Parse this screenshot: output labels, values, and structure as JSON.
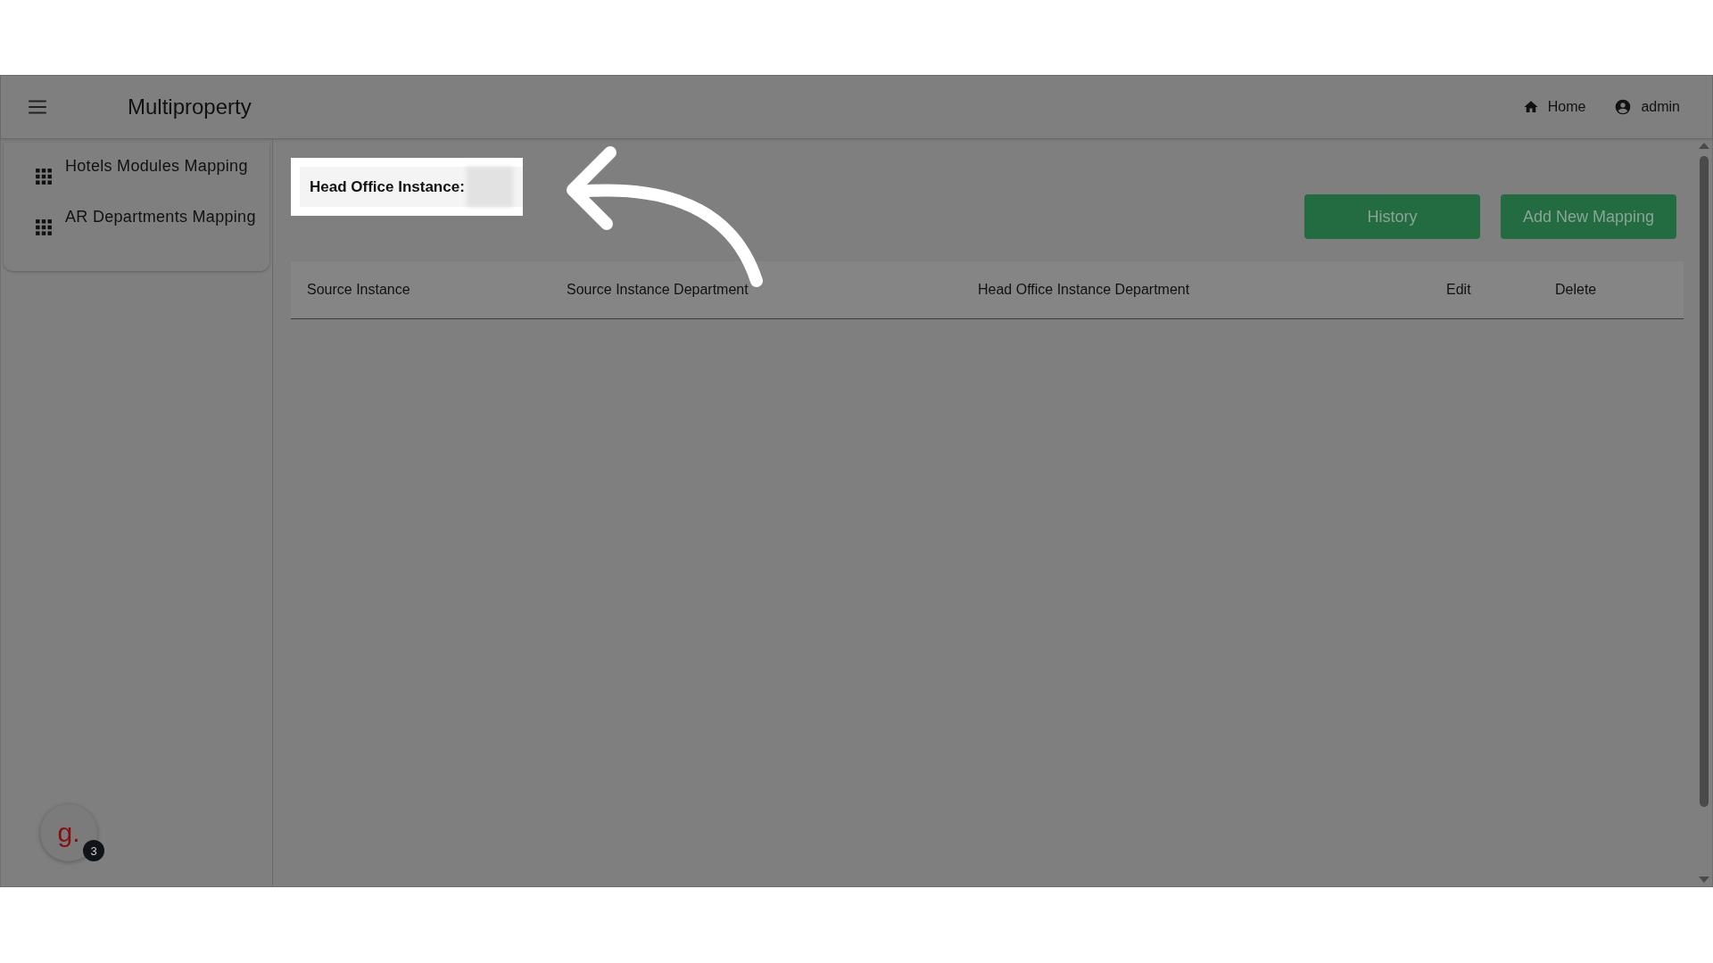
{
  "app_bar": {
    "title": "Multiproperty",
    "links": [
      {
        "kind": "home",
        "label": "Home"
      },
      {
        "kind": "user",
        "label": "admin"
      }
    ]
  },
  "sidebar": {
    "items": [
      {
        "label": "Hotels Modules Mapping"
      },
      {
        "label": "AR Departments Mapping"
      }
    ]
  },
  "highlight": {
    "label": "Head Office Instance:"
  },
  "buttons": [
    {
      "label": "History"
    },
    {
      "label": "Add New Mapping"
    }
  ],
  "table": {
    "columns": [
      "Source Instance",
      "Source Instance Department",
      "Head Office Instance Department",
      "Edit",
      "Delete"
    ]
  },
  "chat_widget": {
    "logo": "g.",
    "badge": "3"
  }
}
